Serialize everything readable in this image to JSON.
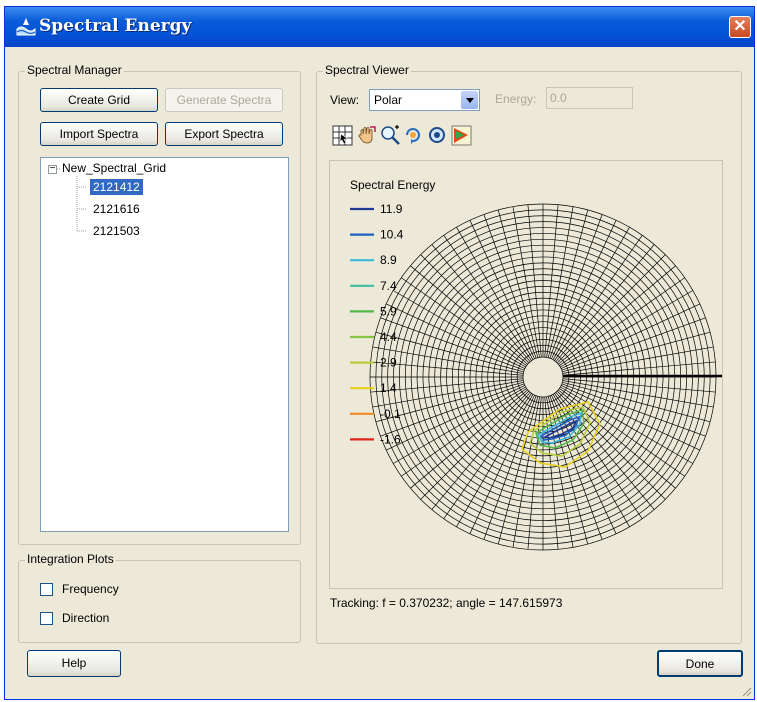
{
  "window": {
    "title": "Spectral Energy",
    "close_label": "✕"
  },
  "spectral_manager": {
    "title": "Spectral Manager",
    "create_grid": "Create Grid",
    "generate_spectra": "Generate Spectra",
    "import_spectra": "Import Spectra",
    "export_spectra": "Export Spectra",
    "tree": {
      "expander": "−",
      "root": "New_Spectral_Grid",
      "items": [
        "2121412",
        "2121616",
        "2121503"
      ],
      "selected_index": 0
    }
  },
  "integration_plots": {
    "title": "Integration Plots",
    "frequency": "Frequency",
    "direction": "Direction"
  },
  "spectral_viewer": {
    "title": "Spectral Viewer",
    "view_label": "View:",
    "view_value": "Polar",
    "energy_label": "Energy:",
    "energy_value": "0.0",
    "toolbar_icons": [
      "grid-select-icon",
      "hand-pan-icon",
      "zoom-in-icon",
      "rotate-icon",
      "zoom-extents-icon",
      "color-fill-icon"
    ],
    "tracking": "Tracking: f = 0.370232; angle = 147.615973"
  },
  "legend": {
    "title": "Spectral Energy",
    "entries": [
      {
        "label": "11.9",
        "color": "#1f3a93"
      },
      {
        "label": "10.4",
        "color": "#1c5fc0"
      },
      {
        "label": "8.9",
        "color": "#3bb8d8"
      },
      {
        "label": "7.4",
        "color": "#3fbf9f"
      },
      {
        "label": "5.9",
        "color": "#54b848"
      },
      {
        "label": "4.4",
        "color": "#86c540"
      },
      {
        "label": "2.9",
        "color": "#b7cc3a"
      },
      {
        "label": "1.4",
        "color": "#e8d01a"
      },
      {
        "label": "-0.1",
        "color": "#f08a24"
      },
      {
        "label": "-1.6",
        "color": "#e0251b"
      }
    ]
  },
  "footer": {
    "help": "Help",
    "done": "Done"
  }
}
